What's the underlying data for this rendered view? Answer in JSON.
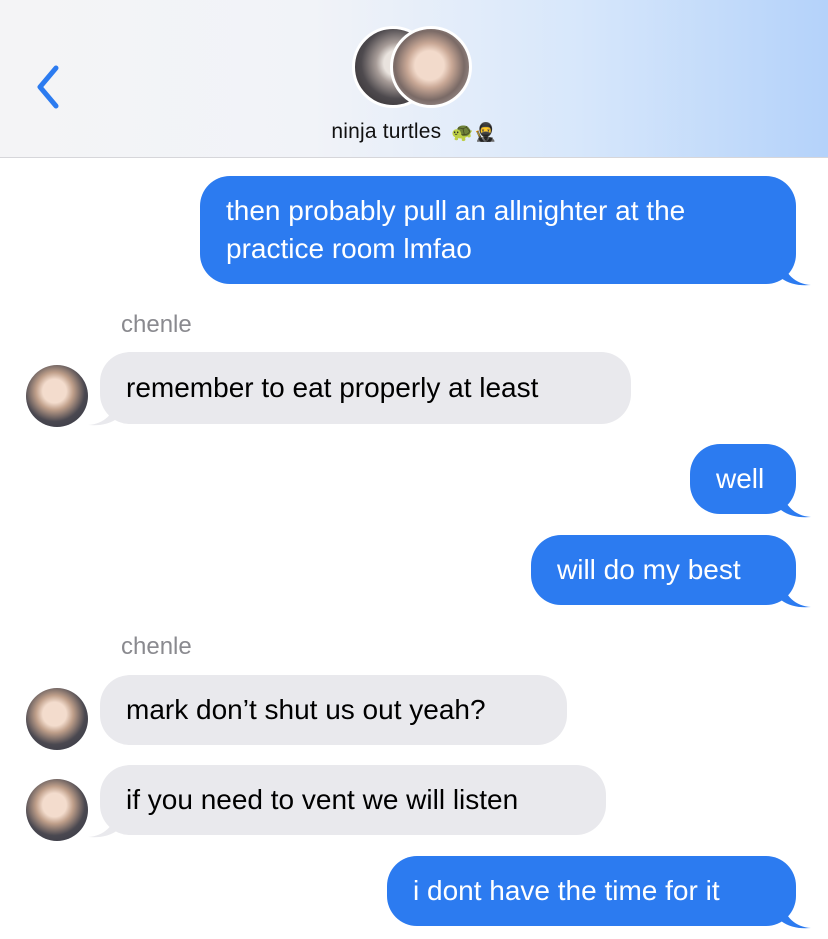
{
  "header": {
    "group_name": "ninja turtles",
    "emoji": "🐢🥷"
  },
  "messages": [
    {
      "direction": "out",
      "text": "then probably pull an allnighter at the practice room lmfao"
    },
    {
      "sender": "chenle"
    },
    {
      "direction": "in",
      "text": "remember to eat properly at least"
    },
    {
      "direction": "out",
      "text": "well"
    },
    {
      "direction": "out",
      "text": "will do my best"
    },
    {
      "sender": "chenle"
    },
    {
      "direction": "in",
      "text": "mark don’t shut us out yeah?"
    },
    {
      "direction": "in",
      "text": "if you need to vent we will listen"
    },
    {
      "direction": "out",
      "text": "i dont have the time for it"
    }
  ],
  "colors": {
    "outgoing_bubble": "#2c7bf0",
    "incoming_bubble": "#e9e9ed",
    "back_arrow": "#2c7bf0"
  },
  "icons": {
    "back": "chevron-left-icon"
  }
}
